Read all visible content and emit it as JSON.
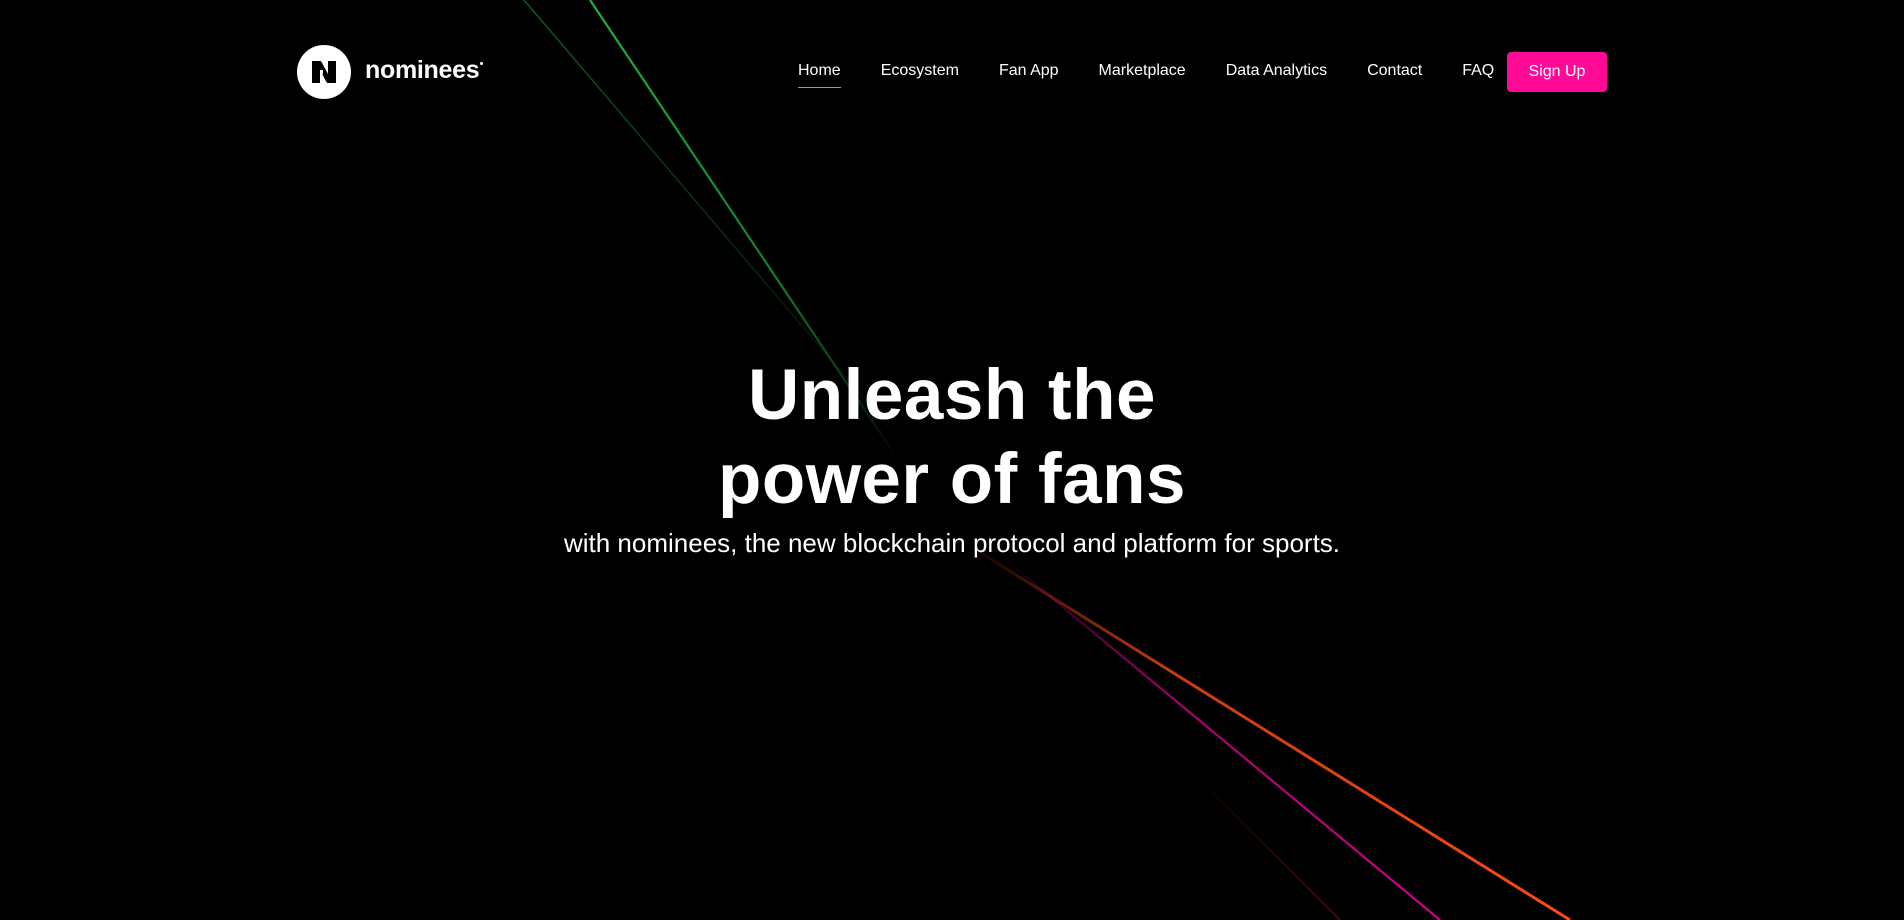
{
  "brand": {
    "name": "nominees",
    "accent_color": "#ff0a96",
    "logo_icon": "n-logo-icon"
  },
  "nav": {
    "items": [
      {
        "label": "Home",
        "active": true
      },
      {
        "label": "Ecosystem",
        "active": false
      },
      {
        "label": "Fan App",
        "active": false
      },
      {
        "label": "Marketplace",
        "active": false
      },
      {
        "label": "Data Analytics",
        "active": false
      },
      {
        "label": "Contact",
        "active": false
      },
      {
        "label": "FAQ",
        "active": false
      }
    ],
    "cta_label": "Sign Up"
  },
  "hero": {
    "title_line1": "Unleash the",
    "title_line2": "power of fans",
    "subtitle": "with nominees, the new blockchain protocol and platform for sports."
  },
  "background": {
    "beam_colors": [
      "#1db33a",
      "#0f6b22",
      "#ff4a12",
      "#d3008c",
      "#8a1a00"
    ]
  }
}
